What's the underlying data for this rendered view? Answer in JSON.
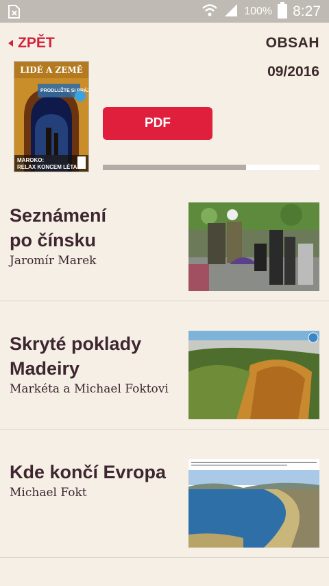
{
  "status_bar": {
    "battery": "100%",
    "time": "8:27",
    "icons": [
      "notification-icon",
      "wifi-icon",
      "signal-icon",
      "battery-icon"
    ]
  },
  "header": {
    "back_label": "ZPĚT",
    "contents_label": "OBSAH"
  },
  "issue": {
    "date": "09/2016",
    "cover": {
      "masthead": "LIDÉ A ZEMĚ",
      "headline1": "PRODLUŽTE SI PRÁZDNINY",
      "headline2": "MAROKO:",
      "headline3": "RELAX KONCEM LÉTA"
    },
    "pdf_label": "PDF",
    "download_progress": 0.66
  },
  "articles": [
    {
      "title_line1": "Seznámení",
      "title_line2": "po čínsku",
      "author": "Jaromír Marek",
      "image": "people-park-photo"
    },
    {
      "title_line1": "Skryté poklady",
      "title_line2": "Madeiry",
      "author": "Markéta a Michael Foktovi",
      "image": "madeira-cliff-photo"
    },
    {
      "title_line1": "Kde končí Evropa",
      "title_line2": "",
      "author": "Michael Fokt",
      "image": "coastline-photo"
    }
  ],
  "colors": {
    "accent": "#e01f3d",
    "background": "#f5efe6",
    "text": "#3e2630"
  }
}
